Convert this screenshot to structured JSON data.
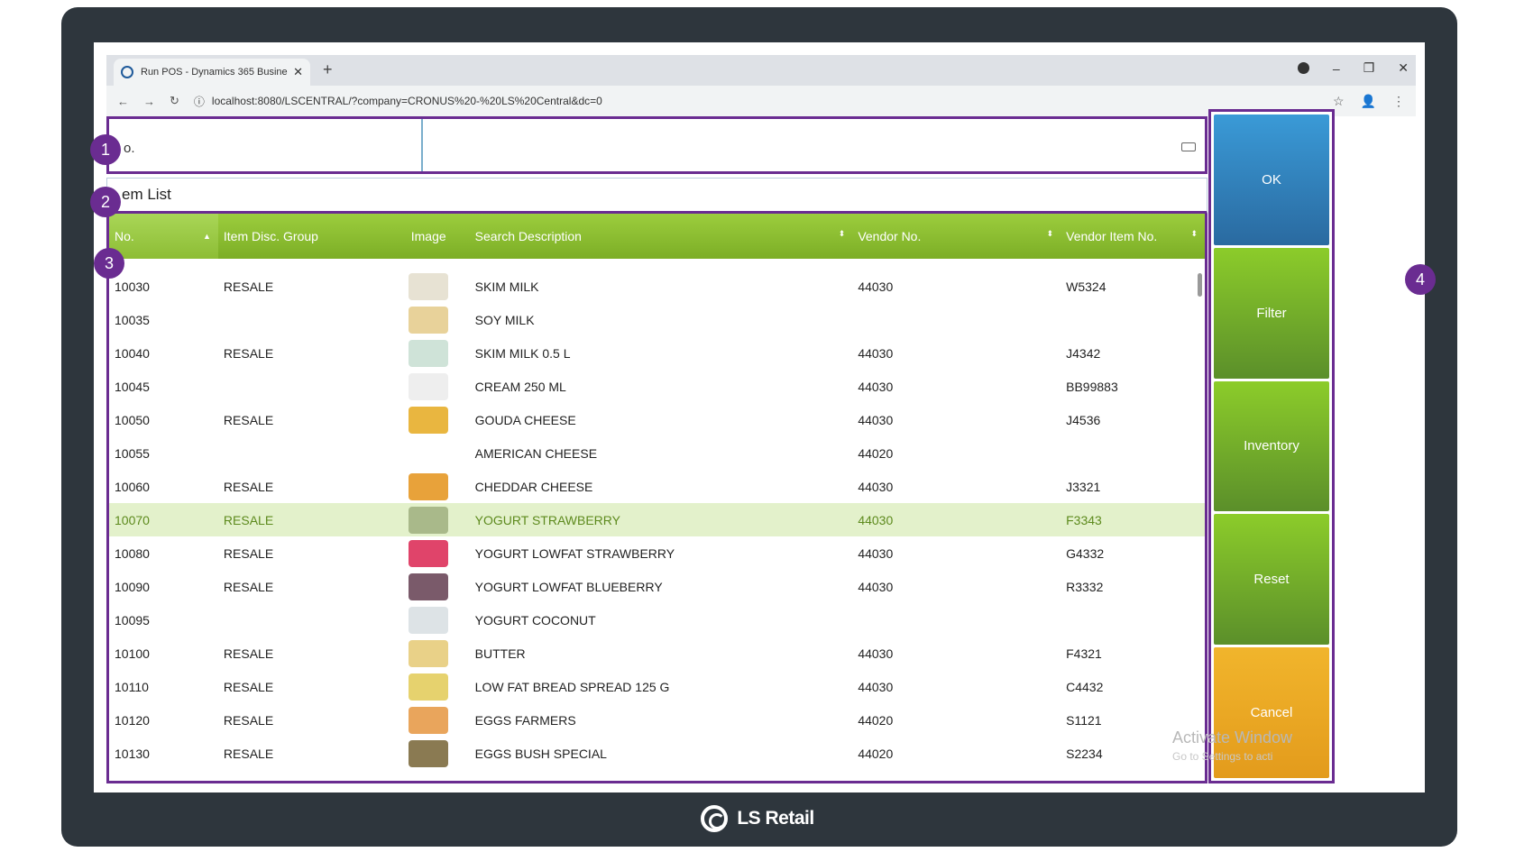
{
  "browser": {
    "tab_title": "Run POS - Dynamics 365 Busine:",
    "tab_close": "✕",
    "new_tab": "+",
    "url": "localhost:8080/LSCENTRAL/?company=CRONUS%20-%20LS%20Central&dc=0",
    "back": "←",
    "forward": "→",
    "reload": "↻",
    "info": "ⓘ",
    "star": "☆",
    "profile": "👤",
    "menu": "⋮",
    "minimize": "–",
    "restore": "❐",
    "close": "✕"
  },
  "pos": {
    "input_label": "o.",
    "list_title": "em List",
    "columns": [
      "No.",
      "Item Disc. Group",
      "Image",
      "Search Description",
      "Vendor No.",
      "Vendor Item No."
    ],
    "rows": [
      {
        "no": "10030",
        "group": "RESALE",
        "desc": "SKIM MILK",
        "vendor": "44030",
        "vitem": "W5324",
        "thumb": "#e7e2d3"
      },
      {
        "no": "10035",
        "group": "",
        "desc": "SOY MILK",
        "vendor": "",
        "vitem": "",
        "thumb": "#e8d29a"
      },
      {
        "no": "10040",
        "group": "RESALE",
        "desc": "SKIM MILK 0.5 L",
        "vendor": "44030",
        "vitem": "J4342",
        "thumb": "#cfe3d8"
      },
      {
        "no": "10045",
        "group": "",
        "desc": "CREAM 250 ML",
        "vendor": "44030",
        "vitem": "BB99883",
        "thumb": "#eeeeee"
      },
      {
        "no": "10050",
        "group": "RESALE",
        "desc": "GOUDA CHEESE",
        "vendor": "44030",
        "vitem": "J4536",
        "thumb": "#e9b640"
      },
      {
        "no": "10055",
        "group": "",
        "desc": "AMERICAN CHEESE",
        "vendor": "44020",
        "vitem": "",
        "thumb": ""
      },
      {
        "no": "10060",
        "group": "RESALE",
        "desc": "CHEDDAR CHEESE",
        "vendor": "44030",
        "vitem": "J3321",
        "thumb": "#e8a23a"
      },
      {
        "no": "10070",
        "group": "RESALE",
        "desc": "YOGURT STRAWBERRY",
        "vendor": "44030",
        "vitem": "F3343",
        "thumb": "#a9b98a",
        "selected": true
      },
      {
        "no": "10080",
        "group": "RESALE",
        "desc": "YOGURT LOWFAT STRAWBERRY",
        "vendor": "44030",
        "vitem": "G4332",
        "thumb": "#e0446a"
      },
      {
        "no": "10090",
        "group": "RESALE",
        "desc": "YOGURT LOWFAT BLUEBERRY",
        "vendor": "44030",
        "vitem": "R3332",
        "thumb": "#7a5a6a"
      },
      {
        "no": "10095",
        "group": "",
        "desc": "YOGURT COCONUT",
        "vendor": "",
        "vitem": "",
        "thumb": "#dde3e6"
      },
      {
        "no": "10100",
        "group": "RESALE",
        "desc": "BUTTER",
        "vendor": "44030",
        "vitem": "F4321",
        "thumb": "#e9d188"
      },
      {
        "no": "10110",
        "group": "RESALE",
        "desc": "LOW FAT BREAD SPREAD 125 G",
        "vendor": "44030",
        "vitem": "C4432",
        "thumb": "#e6d26e"
      },
      {
        "no": "10120",
        "group": "RESALE",
        "desc": "EGGS FARMERS",
        "vendor": "44020",
        "vitem": "S1121",
        "thumb": "#e9a55c"
      },
      {
        "no": "10130",
        "group": "RESALE",
        "desc": "EGGS BUSH SPECIAL",
        "vendor": "44020",
        "vitem": "S2234",
        "thumb": "#8a7a52"
      }
    ],
    "buttons": {
      "ok": "OK",
      "filter": "Filter",
      "inventory": "Inventory",
      "reset": "Reset",
      "cancel": "Cancel"
    }
  },
  "callouts": [
    "1",
    "2",
    "3",
    "4"
  ],
  "watermark": {
    "line1": "Activate Window",
    "line2": "Go to Settings to acti"
  },
  "brand": "LS Retail",
  "colors": {
    "accent": "#6a2c91",
    "header_green": "#8cbf30",
    "ok_blue": "#3a8cc8",
    "cancel_orange": "#eeaa25"
  }
}
